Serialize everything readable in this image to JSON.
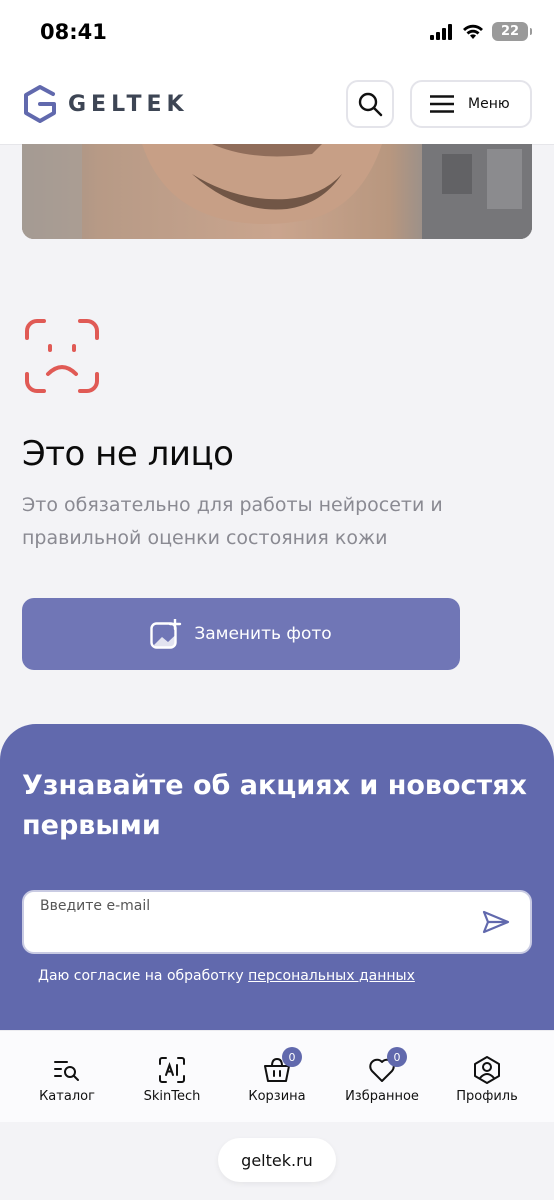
{
  "status_bar": {
    "time": "08:41",
    "battery": "22"
  },
  "header": {
    "logo_text": "GELTEK",
    "menu_label": "Меню"
  },
  "error": {
    "title": "Это не лицо",
    "description": "Это обязательно для работы нейросети и правильной оценки состояния кожи",
    "replace_button": "Заменить фото"
  },
  "newsletter": {
    "title": "Узнавайте об акциях и новостях первыми",
    "email_placeholder": "Введите e-mail",
    "consent_text": "Даю согласие на обработку ",
    "consent_link": "персональных данных"
  },
  "bottom_nav": {
    "items": [
      {
        "label": "Каталог",
        "icon": "catalog-search-icon"
      },
      {
        "label": "SkinTech",
        "icon": "ai-scan-icon"
      },
      {
        "label": "Корзина",
        "icon": "basket-icon",
        "badge": "0"
      },
      {
        "label": "Избранное",
        "icon": "heart-icon",
        "badge": "0"
      },
      {
        "label": "Профиль",
        "icon": "user-icon"
      }
    ]
  },
  "url_bar": {
    "url": "geltek.ru"
  },
  "colors": {
    "accent": "#6169ad",
    "button": "#7076b6",
    "error_icon": "#e05a55"
  }
}
